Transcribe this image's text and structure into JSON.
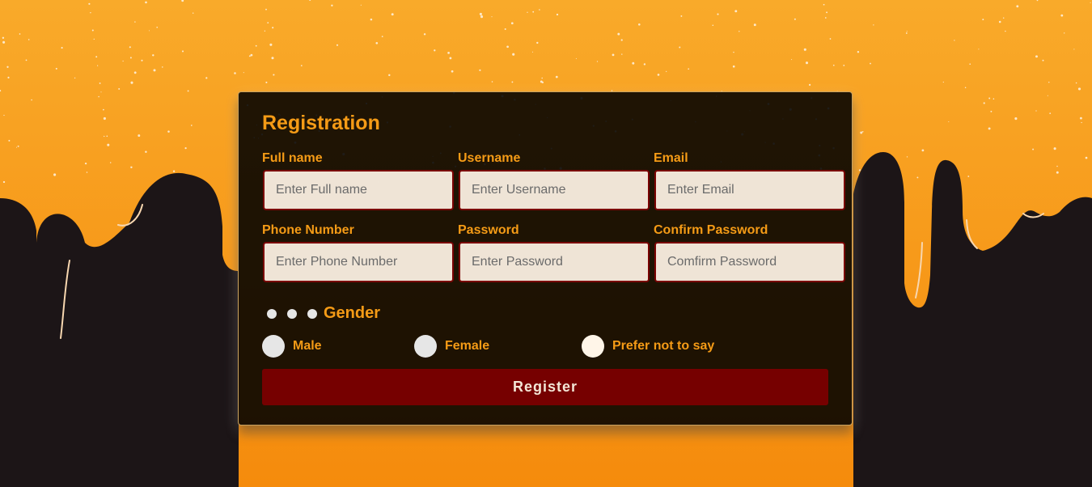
{
  "colors": {
    "background_orange": "#f7941d",
    "drip_dark": "#1c1517",
    "accent": "#f59b16",
    "button": "#760000",
    "input_border": "#7a0303"
  },
  "form": {
    "title": "Registration",
    "fields": [
      {
        "label": "Full name",
        "placeholder": "Enter Full name"
      },
      {
        "label": "Username",
        "placeholder": "Enter Username"
      },
      {
        "label": "Email",
        "placeholder": "Enter Email"
      },
      {
        "label": "Phone Number",
        "placeholder": "Enter Phone Number"
      },
      {
        "label": "Password",
        "placeholder": "Enter Password"
      },
      {
        "label": "Confirm Password",
        "placeholder": "Comfirm Password"
      }
    ],
    "gender": {
      "title": "Gender",
      "options": [
        {
          "label": "Male",
          "selected": false
        },
        {
          "label": "Female",
          "selected": false
        },
        {
          "label": "Prefer not to say",
          "selected": false
        }
      ]
    },
    "submit_label": "Register"
  }
}
